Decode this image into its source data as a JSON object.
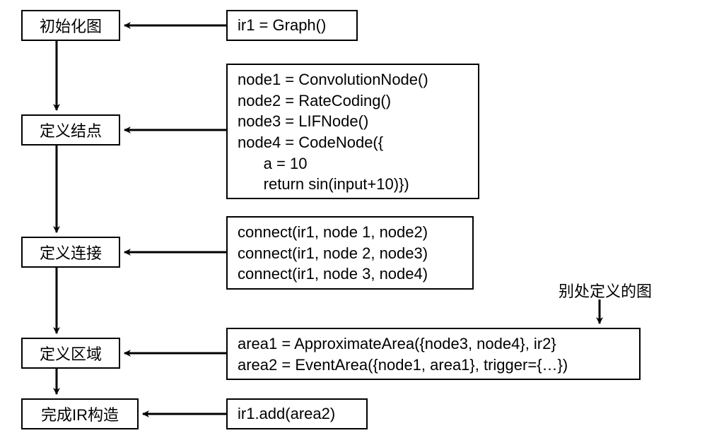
{
  "steps": {
    "s1": "初始化图",
    "s2": "定义结点",
    "s3": "定义连接",
    "s4": "定义区域",
    "s5": "完成IR构造"
  },
  "code": {
    "c1": "ir1 = Graph()",
    "c2": "node1 = ConvolutionNode()\nnode2 = RateCoding()\nnode3 = LIFNode()\nnode4 = CodeNode({\n      a = 10\n      return sin(input+10)})",
    "c3": "connect(ir1, node 1, node2)\nconnect(ir1, node 2, node3)\nconnect(ir1, node 3, node4)",
    "c4": "area1 = ApproximateArea({node3, node4}, ir2}\narea2 = EventArea({node1, area1}, trigger={…})",
    "c5": "ir1.add(area2)"
  },
  "annotation": "别处定义的图"
}
